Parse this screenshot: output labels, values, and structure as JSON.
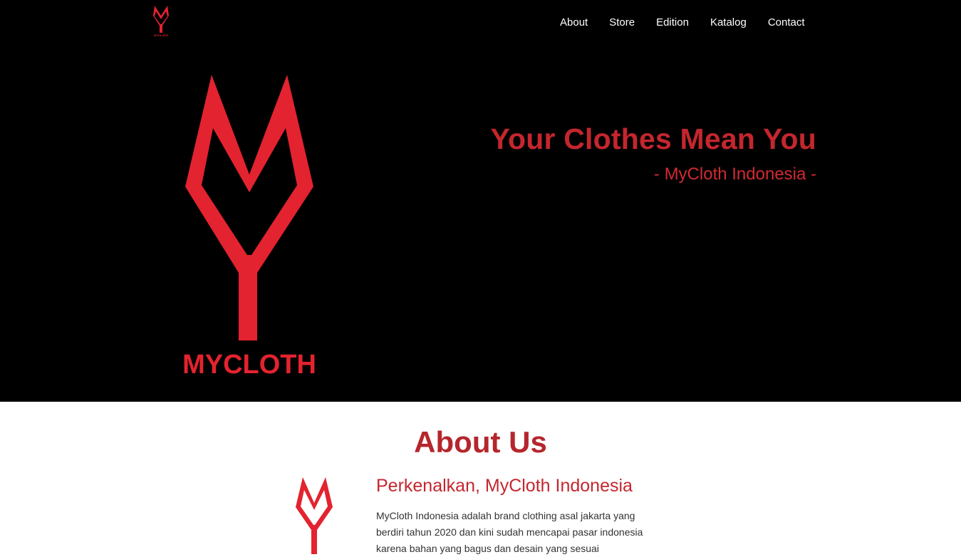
{
  "colors": {
    "accent": "#e3232f",
    "title_red": "#c4262e",
    "hero_bg": "#000000",
    "nav_text": "#ffffff"
  },
  "brand": {
    "wordmark": "MYCLOTH",
    "small_wordmark": "MYCLOTH"
  },
  "nav": {
    "items": [
      "About",
      "Store",
      "Edition",
      "Katalog",
      "Contact"
    ]
  },
  "hero": {
    "title": "Your Clothes Mean You",
    "subtitle": "- MyCloth Indonesia -"
  },
  "about": {
    "title": "About Us",
    "heading": "Perkenalkan, MyCloth Indonesia",
    "text": "MyCloth Indonesia adalah brand clothing asal jakarta yang berdiri tahun 2020 dan kini sudah mencapai pasar indonesia karena bahan yang bagus dan desain yang sesuai"
  }
}
